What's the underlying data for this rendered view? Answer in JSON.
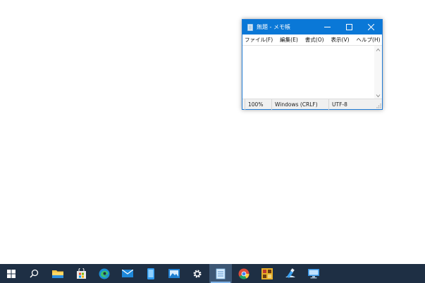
{
  "notepad": {
    "title": "無題 - メモ帳",
    "menu": [
      "ファイル(F)",
      "編集(E)",
      "書式(O)",
      "表示(V)",
      "ヘルプ(H)"
    ],
    "status": {
      "zoom": "100%",
      "line_ending": "Windows (CRLF)",
      "encoding": "UTF-8"
    }
  },
  "taskbar": {
    "items": [
      "start-icon",
      "search-icon",
      "file-explorer-icon",
      "store-icon",
      "edge-icon",
      "mail-icon",
      "phone-icon",
      "photos-icon",
      "settings-icon",
      "notepad-icon",
      "chrome-icon",
      "game-icon",
      "paint-icon",
      "remote-desktop-icon"
    ],
    "active_item": "notepad-icon"
  },
  "colors": {
    "titlebar": "#0a78d7",
    "taskbar": "#1e2f44",
    "accent": "#7fb3e8"
  }
}
